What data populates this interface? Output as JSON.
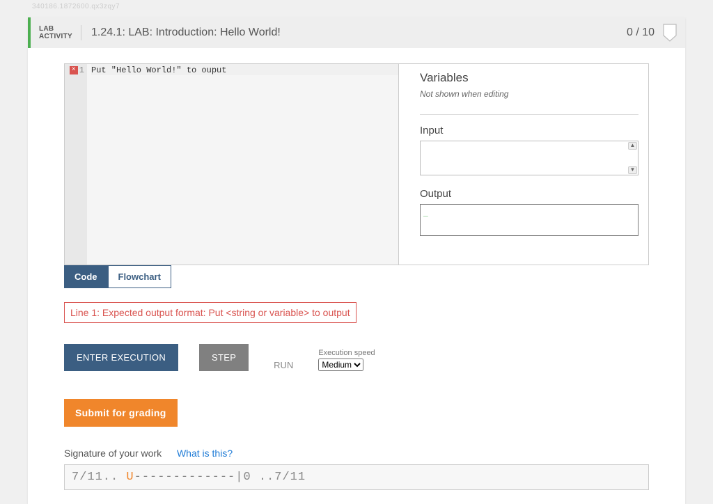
{
  "faint_id": "340186.1872600.qx3zqy7",
  "header": {
    "tag_line1": "LAB",
    "tag_line2": "ACTIVITY",
    "title": "1.24.1: LAB: Introduction: Hello World!",
    "score": "0 / 10"
  },
  "editor": {
    "line_number": "1",
    "error_mark": "×",
    "code_line1": "Put \"Hello World!\" to ouput"
  },
  "side": {
    "variables_heading": "Variables",
    "variables_note": "Not shown when editing",
    "input_heading": "Input",
    "output_heading": "Output",
    "output_cursor": "_"
  },
  "tabs": {
    "code": "Code",
    "flowchart": "Flowchart"
  },
  "error_message": "Line 1: Expected output format: Put <string or variable> to output",
  "controls": {
    "enter": "ENTER EXECUTION",
    "step": "STEP",
    "run": "RUN",
    "speed_label": "Execution speed",
    "speed_value": "Medium"
  },
  "submit_label": "Submit for grading",
  "signature": {
    "label": "Signature of your work",
    "link": "What is this?",
    "prefix": "7/11.. ",
    "mid": "U",
    "dashes": "-------------",
    "suffix": "|0 ..7/11"
  }
}
